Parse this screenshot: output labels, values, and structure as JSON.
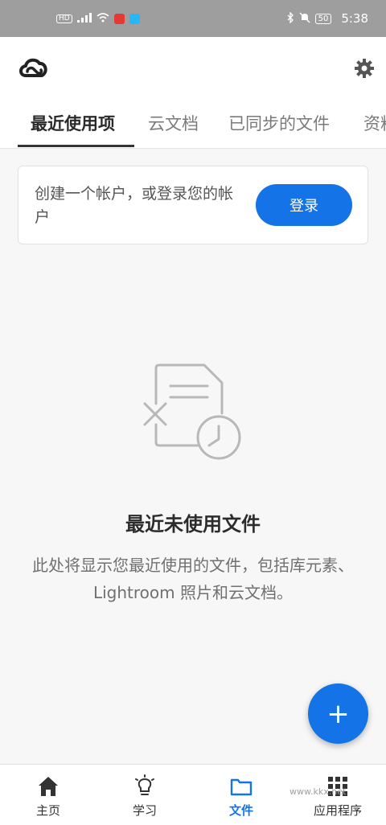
{
  "status_bar": {
    "indicators": [
      "hd-icon",
      "signal-icon",
      "wifi-icon",
      "app-notification-icon",
      "app-notification-icon-2"
    ],
    "right_icons": [
      "bluetooth-icon",
      "mute-icon"
    ],
    "hd_label": "HD",
    "battery": "50",
    "time": "5:38"
  },
  "app_bar": {
    "logo_icon": "creative-cloud-logo-icon",
    "settings_icon": "gear-icon"
  },
  "tabs": [
    {
      "label": "最近使用项",
      "active": true
    },
    {
      "label": "云文档",
      "active": false
    },
    {
      "label": "已同步的文件",
      "active": false
    },
    {
      "label": "资料",
      "active": false
    }
  ],
  "login_card": {
    "message": "创建一个帐户，或登录您的帐户",
    "button_label": "登录"
  },
  "empty_state": {
    "icon": "document-recent-icon",
    "title": "最近未使用文件",
    "description": "此处将显示您最近使用的文件，包括库元素、Lightroom 照片和云文档。"
  },
  "fab": {
    "label": "+",
    "icon": "plus-icon"
  },
  "bottom_nav": [
    {
      "label": "主页",
      "icon": "home-icon",
      "active": false
    },
    {
      "label": "学习",
      "icon": "lightbulb-icon",
      "active": false
    },
    {
      "label": "文件",
      "icon": "folder-icon",
      "active": true
    },
    {
      "label": "应用程序",
      "icon": "apps-grid-icon",
      "active": false
    }
  ],
  "colors": {
    "accent": "#1473e6",
    "status_bar": "#9e9e9e",
    "background": "#f7f7f7"
  },
  "watermark": "www.kkx.net"
}
